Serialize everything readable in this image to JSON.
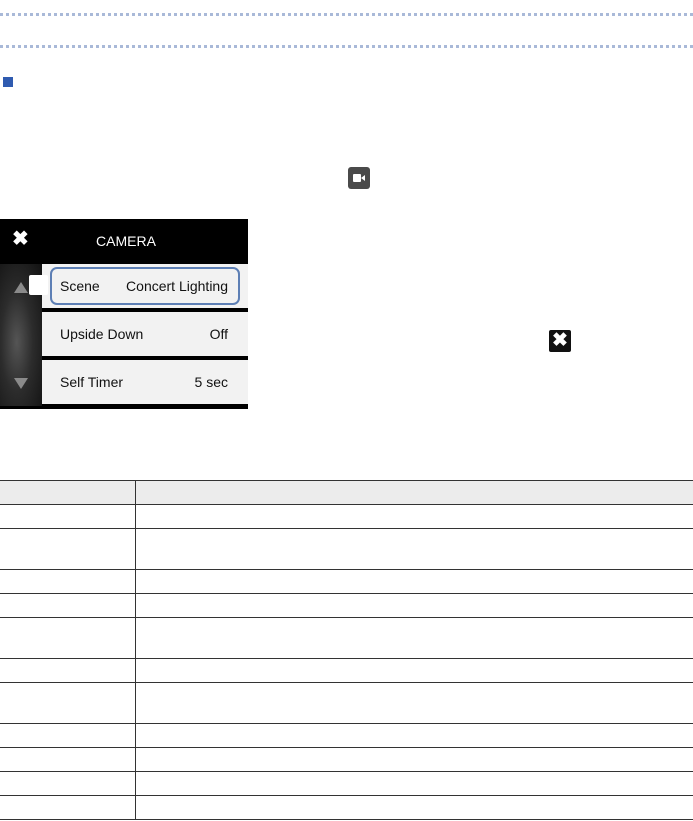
{
  "camera_screen": {
    "title": "CAMERA",
    "close_icon": "close-x-icon",
    "scroll_up_icon": "up-arrow-icon",
    "scroll_down_icon": "down-arrow-icon",
    "rows": [
      {
        "label": "Scene",
        "value": "Concert Lighting"
      },
      {
        "label": "Upside Down",
        "value": "Off"
      },
      {
        "label": "Self Timer",
        "value": "5 sec"
      }
    ]
  },
  "inline_icons": [
    "camera-icon",
    "close-square-icon"
  ],
  "colors": {
    "accent": "#2f5bb0",
    "selection_outline": "#5d7fb5",
    "divider_dots": "#a9b9d8"
  },
  "table": {
    "row_count": 13,
    "header_shaded": true
  }
}
